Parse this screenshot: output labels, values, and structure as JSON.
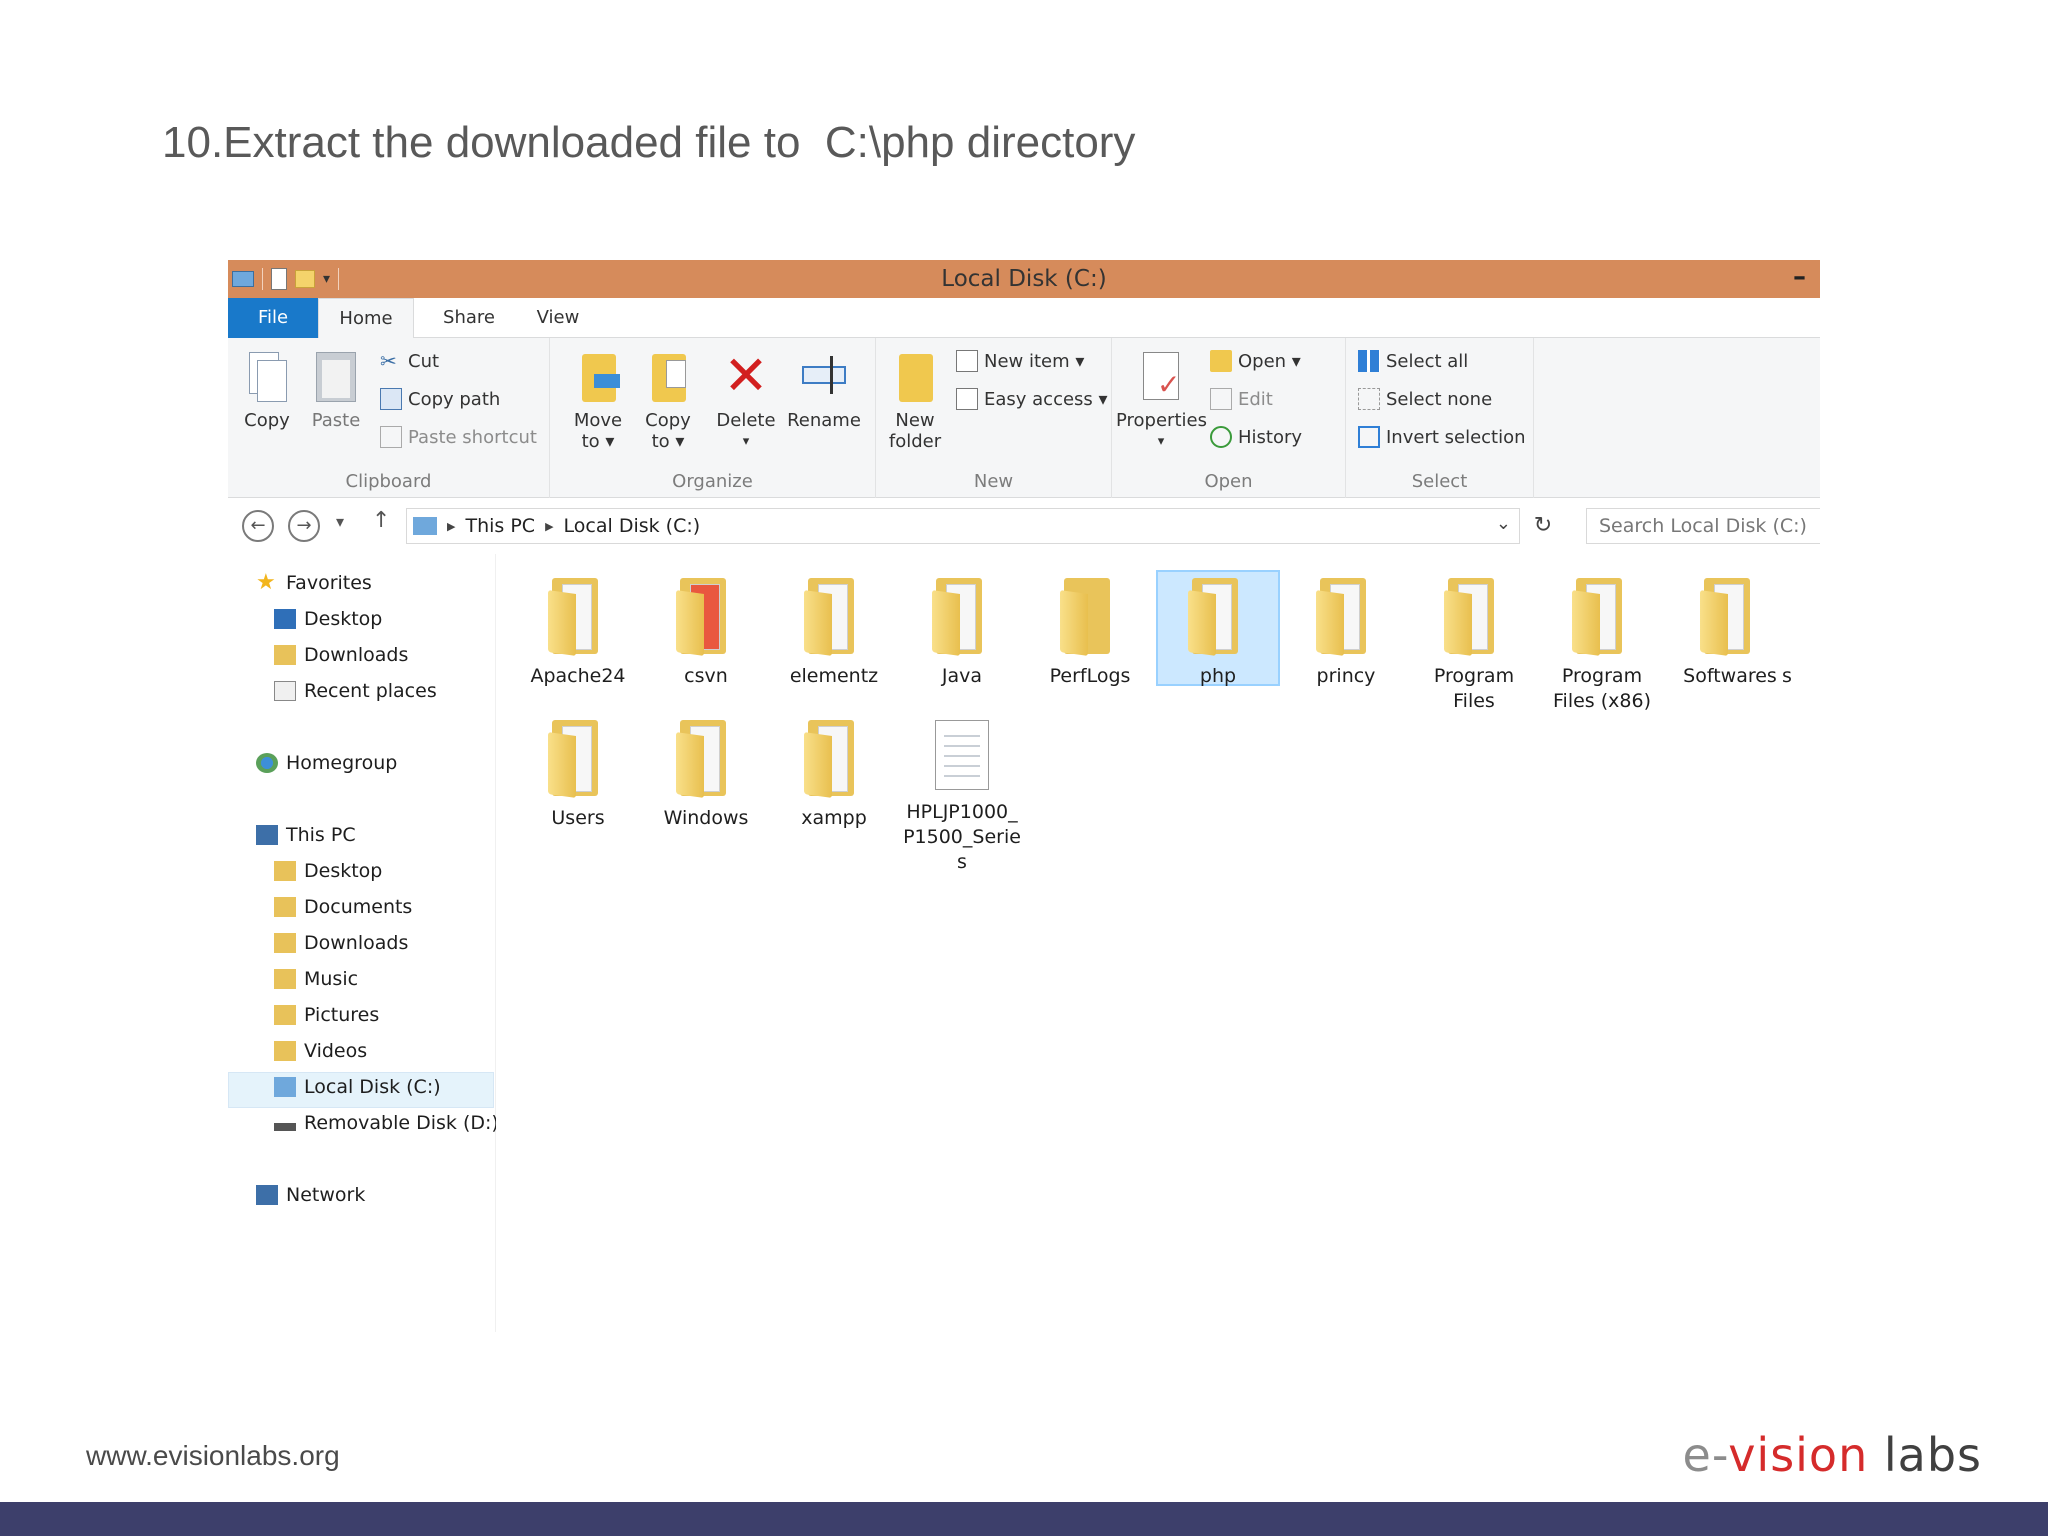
{
  "slide": {
    "title": "10.Extract the downloaded file to  C:\\php directory",
    "footer_url": "www.evisionlabs.org",
    "brand": {
      "e": "e",
      "dash": "-",
      "vision": "vision",
      "labs": " labs"
    },
    "colors": {
      "bottom_bar": "#3d3f6b",
      "brand_red": "#d52b2b"
    }
  },
  "window": {
    "title": "Local Disk (C:)",
    "minimize_label": "–",
    "titlebar_color": "#d68b5b",
    "tabs": {
      "file": "File",
      "home": "Home",
      "share": "Share",
      "view": "View"
    },
    "ribbon": {
      "clipboard": {
        "label": "Clipboard",
        "copy": "Copy",
        "paste": "Paste",
        "cut": "Cut",
        "copy_path": "Copy path",
        "paste_shortcut": "Paste shortcut"
      },
      "organize": {
        "label": "Organize",
        "move_to_1": "Move",
        "move_to_2": "to ▾",
        "copy_to_1": "Copy",
        "copy_to_2": "to ▾",
        "delete": "Delete",
        "delete_arrow": "▾",
        "rename": "Rename"
      },
      "new": {
        "label": "New",
        "new_folder_1": "New",
        "new_folder_2": "folder",
        "new_item": "New item ▾",
        "easy_access": "Easy access ▾"
      },
      "open": {
        "label": "Open",
        "properties": "Properties",
        "properties_arrow": "▾",
        "open": "Open ▾",
        "edit": "Edit",
        "history": "History"
      },
      "select": {
        "label": "Select",
        "select_all": "Select all",
        "select_none": "Select none",
        "invert": "Invert selection"
      }
    },
    "address": {
      "crumbs": [
        "This PC",
        "Local Disk (C:)"
      ],
      "search_placeholder": "Search Local Disk (C:)"
    },
    "nav": {
      "favorites": "Favorites",
      "fav_items": [
        "Desktop",
        "Downloads",
        "Recent places"
      ],
      "homegroup": "Homegroup",
      "this_pc": "This PC",
      "pc_items": [
        "Desktop",
        "Documents",
        "Downloads",
        "Music",
        "Pictures",
        "Videos",
        "Local Disk (C:)",
        "Removable Disk (D:)"
      ],
      "network": "Network"
    },
    "files": [
      {
        "name": "Apache24",
        "line2": "",
        "line3": ""
      },
      {
        "name": "csvn",
        "line2": "",
        "line3": ""
      },
      {
        "name": "elementz",
        "line2": "",
        "line3": ""
      },
      {
        "name": "Java",
        "line2": "",
        "line3": ""
      },
      {
        "name": "PerfLogs",
        "line2": "",
        "line3": ""
      },
      {
        "name": "php",
        "line2": "",
        "line3": ""
      },
      {
        "name": "princy",
        "line2": "",
        "line3": ""
      },
      {
        "name": "Program",
        "line2": "Files",
        "line3": ""
      },
      {
        "name": "Program",
        "line2": "Files (x86)",
        "line3": ""
      },
      {
        "name": "Softwares",
        "line2": "",
        "line3": ""
      },
      {
        "name": "s",
        "line2": "",
        "line3": ""
      },
      {
        "name": "Users",
        "line2": "",
        "line3": ""
      },
      {
        "name": "Windows",
        "line2": "",
        "line3": ""
      },
      {
        "name": "xampp",
        "line2": "",
        "line3": ""
      },
      {
        "name": "HPLJP1000_",
        "line2": "P1500_Serie",
        "line3": "s"
      }
    ],
    "selected_file": "php"
  }
}
